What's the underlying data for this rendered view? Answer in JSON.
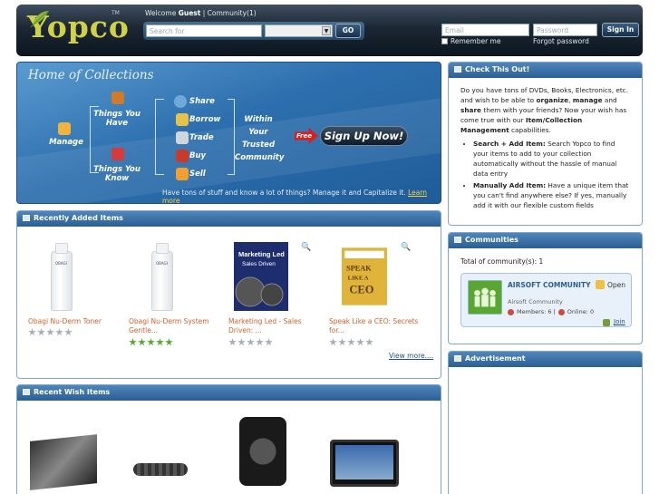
{
  "header": {
    "logo": "Yopco",
    "tm": "TM",
    "welcome_prefix": "Welcome",
    "welcome_user": "Guest",
    "welcome_sep": "|",
    "community_link": "Community(1)",
    "search_placeholder": "Search for",
    "go_label": "GO",
    "email_placeholder": "Email",
    "password_placeholder": "Password",
    "signin_label": "Sign In",
    "remember_label": "Remember me",
    "forgot_label": "Forgot password"
  },
  "banner": {
    "title": "Home of Collections",
    "manage": "Manage",
    "things_you_have": "Things You Have",
    "things_you_know": "Things You Know",
    "actions": [
      "Share",
      "Borrow",
      "Trade",
      "Buy",
      "Sell"
    ],
    "within": "Within Your Trusted Community",
    "free": "Free",
    "signup": "Sign Up Now!",
    "tagline": "Have tons of stuff and know a lot of things? Manage it and Capitalize it.",
    "learn_more": "Learn more"
  },
  "recent": {
    "title": "Recently Added Items",
    "items": [
      {
        "name": "Obagi Nu-Derm Toner",
        "rating": 0
      },
      {
        "name": "Obagi Nu-Derm System Gentle...",
        "rating": 5
      },
      {
        "name": "Marketing Led - Sales Driven: ...",
        "rating": 0
      },
      {
        "name": "Speak Like a CEO: Secrets for...",
        "rating": 0
      }
    ],
    "view_more": "View more...."
  },
  "wish": {
    "title": "Recent Wish Items"
  },
  "check": {
    "title": "Check This Out!",
    "intro_1": "Do you have tons of DVDs, Books, Electronics, etc. and wish to be able to ",
    "organize": "organize",
    "comma": ", ",
    "manage": "manage",
    "and": " and ",
    "share": "share",
    "intro_2": " them with your friends?  Now your wish has come true with our ",
    "feature": "Item/Collection Management",
    "intro_3": " capabilities.",
    "b1_bold": "Search + Add Item:",
    "b1_text": " Search Yopco to find your items to add to your collection automatically without the hassle of manual data entry",
    "b2_bold": "Manually Add Item:",
    "b2_text": " Have a unique item that you can't find anywhere else?  If yes, manually add it with our flexible custom fields"
  },
  "communities": {
    "title": "Communities",
    "total": "Total of community(s): 1",
    "name": "AIRSOFT COMMUNITY",
    "open": "Open",
    "desc": "Airsoft Community",
    "members": "Members: 6 |",
    "online": "Online: 0",
    "join": "Join"
  },
  "advertisement": {
    "title": "Advertisement"
  },
  "colors": {
    "accent": "#2c5f93",
    "link_orange": "#d4602a",
    "star_on": "#5aa632"
  }
}
